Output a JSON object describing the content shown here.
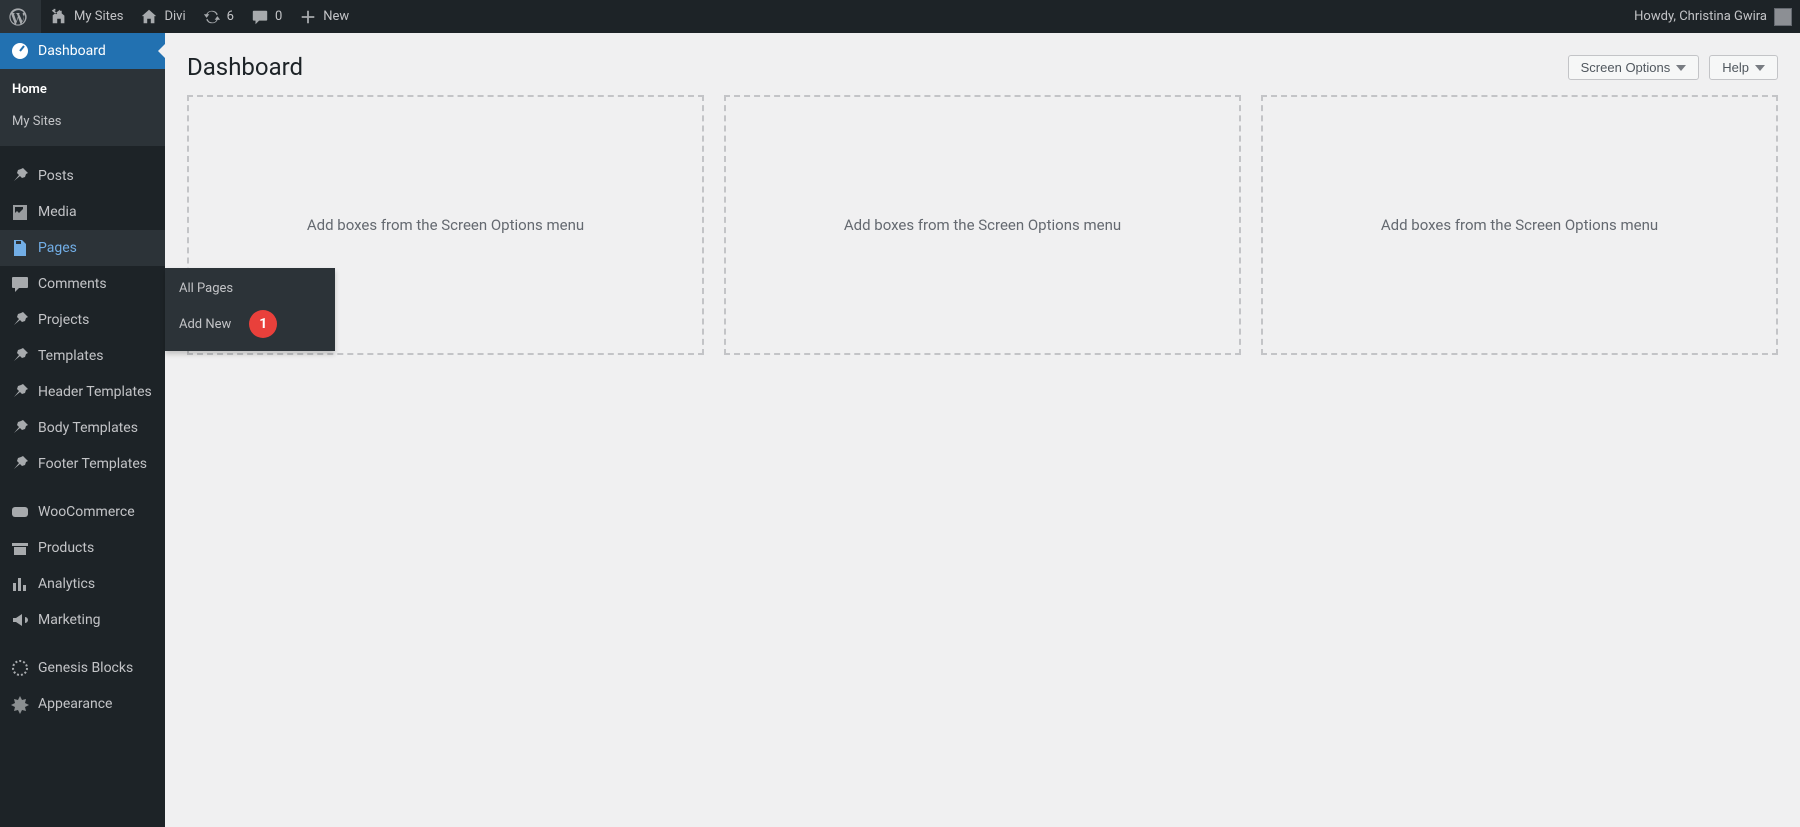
{
  "adminbar": {
    "my_sites": "My Sites",
    "site_name": "Divi",
    "updates": "6",
    "comments": "0",
    "new": "New",
    "greeting": "Howdy, Christina Gwira"
  },
  "sidebar": {
    "dashboard": "Dashboard",
    "dashboard_sub": {
      "home": "Home",
      "my_sites": "My Sites"
    },
    "posts": "Posts",
    "media": "Media",
    "pages": "Pages",
    "pages_sub": {
      "all": "All Pages",
      "add_new": "Add New"
    },
    "comments": "Comments",
    "projects": "Projects",
    "templates": "Templates",
    "header_templates": "Header Templates",
    "body_templates": "Body Templates",
    "footer_templates": "Footer Templates",
    "woocommerce": "WooCommerce",
    "products": "Products",
    "analytics": "Analytics",
    "marketing": "Marketing",
    "genesis_blocks": "Genesis Blocks",
    "appearance": "Appearance"
  },
  "main": {
    "title": "Dashboard",
    "screen_options": "Screen Options",
    "help": "Help",
    "placeholder_text": "Add boxes from the Screen Options menu"
  },
  "annotation": {
    "step1": "1"
  }
}
